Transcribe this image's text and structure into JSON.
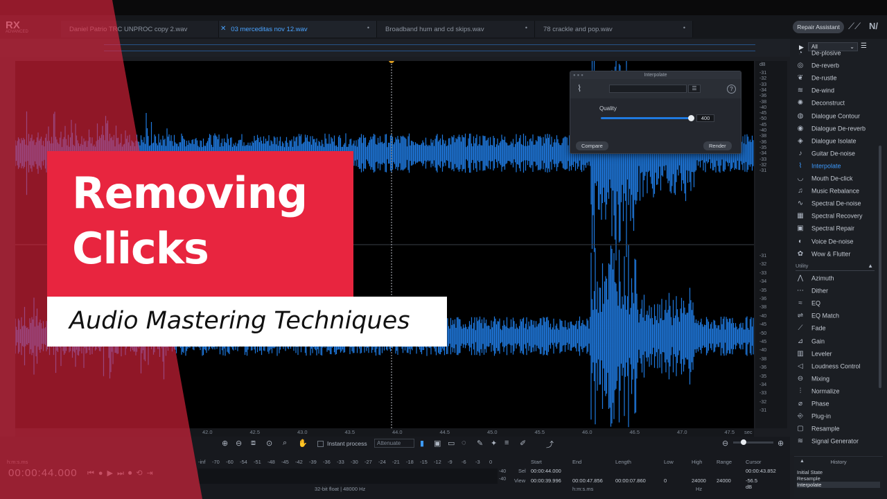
{
  "app": {
    "logo": "RX",
    "logo_sub": "ADVANCED"
  },
  "tabs": [
    {
      "label": "Daniel Patrio TRC UNPROC copy 2.wav",
      "active": false
    },
    {
      "label": "03 merceditas nov 12.wav",
      "active": true
    },
    {
      "label": "Broadband hum and cd skips.wav",
      "active": false
    },
    {
      "label": "78 crackle and pop.wav",
      "active": false
    }
  ],
  "header": {
    "repair_assistant": "Repair Assistant"
  },
  "overlay": {
    "title_line1": "Removing",
    "title_line2": "Clicks",
    "subtitle": "Audio Mastering Techniques",
    "accent": "#e8253f"
  },
  "dialog": {
    "title": "Interpolate",
    "quality_label": "Quality",
    "quality_value": "400",
    "quality_fraction": 0.95,
    "compare": "Compare",
    "render": "Render"
  },
  "db_scale": {
    "unit": "dB",
    "top": [
      "-31",
      "-32",
      "-33",
      "-34",
      "-36",
      "-38",
      "-40",
      "-45",
      "-50",
      "-45",
      "-40",
      "-38",
      "-36",
      "-35",
      "-34",
      "-33",
      "-32",
      "-31"
    ],
    "bottom": [
      "-31",
      "-32",
      "-33",
      "-34",
      "-35",
      "-36",
      "-38",
      "-40",
      "-45",
      "-50",
      "-45",
      "-40",
      "-38",
      "-36",
      "-35",
      "-34",
      "-33",
      "-32",
      "-31"
    ]
  },
  "ruler": {
    "ticks": [
      "42.0",
      "42.5",
      "43.0",
      "43.5",
      "44.0",
      "44.5",
      "45.0",
      "45.5",
      "46.0",
      "46.5",
      "47.0",
      "47.5"
    ],
    "unit": "sec"
  },
  "modules": {
    "filter": "All",
    "repair": [
      {
        "label": "De-plosive",
        "icon": "de-plosive-icon"
      },
      {
        "label": "De-reverb",
        "icon": "de-reverb-icon"
      },
      {
        "label": "De-rustle",
        "icon": "de-rustle-icon"
      },
      {
        "label": "De-wind",
        "icon": "de-wind-icon"
      },
      {
        "label": "Deconstruct",
        "icon": "deconstruct-icon"
      },
      {
        "label": "Dialogue Contour",
        "icon": "dialogue-contour-icon"
      },
      {
        "label": "Dialogue De-reverb",
        "icon": "dialogue-de-reverb-icon"
      },
      {
        "label": "Dialogue Isolate",
        "icon": "dialogue-isolate-icon"
      },
      {
        "label": "Guitar De-noise",
        "icon": "guitar-icon"
      },
      {
        "label": "Interpolate",
        "icon": "interpolate-icon",
        "active": true
      },
      {
        "label": "Mouth De-click",
        "icon": "mouth-icon"
      },
      {
        "label": "Music Rebalance",
        "icon": "music-icon"
      },
      {
        "label": "Spectral De-noise",
        "icon": "spectral-de-noise-icon"
      },
      {
        "label": "Spectral Recovery",
        "icon": "spectral-recovery-icon"
      },
      {
        "label": "Spectral Repair",
        "icon": "spectral-repair-icon"
      },
      {
        "label": "Voice De-noise",
        "icon": "voice-icon"
      },
      {
        "label": "Wow & Flutter",
        "icon": "wow-flutter-icon"
      }
    ],
    "utility_label": "Utility",
    "utility": [
      {
        "label": "Azimuth",
        "icon": "azimuth-icon"
      },
      {
        "label": "Dither",
        "icon": "dither-icon"
      },
      {
        "label": "EQ",
        "icon": "eq-icon"
      },
      {
        "label": "EQ Match",
        "icon": "eq-match-icon"
      },
      {
        "label": "Fade",
        "icon": "fade-icon"
      },
      {
        "label": "Gain",
        "icon": "gain-icon"
      },
      {
        "label": "Leveler",
        "icon": "leveler-icon"
      },
      {
        "label": "Loudness Control",
        "icon": "loudness-icon"
      },
      {
        "label": "Mixing",
        "icon": "mixing-icon"
      },
      {
        "label": "Normalize",
        "icon": "normalize-icon"
      },
      {
        "label": "Phase",
        "icon": "phase-icon"
      },
      {
        "label": "Plug-in",
        "icon": "plug-in-icon"
      },
      {
        "label": "Resample",
        "icon": "resample-icon"
      },
      {
        "label": "Signal Generator",
        "icon": "signal-generator-icon"
      }
    ]
  },
  "toolbar": {
    "instant_process": "Instant process",
    "mode": "Attenuate"
  },
  "transport": {
    "time_format": "h:m:s.ms",
    "timecode": "00:00:44.000"
  },
  "meter": {
    "scale": [
      "-inf",
      "-70",
      "-60",
      "-54",
      "-51",
      "-48",
      "-45",
      "-42",
      "-39",
      "-36",
      "-33",
      "-30",
      "-27",
      "-24",
      "-21",
      "-18",
      "-15",
      "-12",
      "-9",
      "-6",
      "-3",
      "0"
    ],
    "right_labels": [
      "-40",
      "-40"
    ],
    "format": "32-bit float | 48000 Hz"
  },
  "selection": {
    "headers": [
      "Start",
      "End",
      "Length",
      "Low",
      "High",
      "Range",
      "Cursor"
    ],
    "sel_label": "Sel",
    "view_label": "View",
    "sel_start": "00:00:44.000",
    "view_start": "00:00:39.996",
    "view_end": "00:00:47.856",
    "view_length": "00:00:07.860",
    "low": "0",
    "high": "24000",
    "range": "24000",
    "cursor": "00:00:43.852",
    "cursor_db": "-56.5 dB",
    "time_unit": "h:m:s.ms",
    "freq_unit": "Hz"
  },
  "history": {
    "title": "History",
    "items": [
      "Initial State",
      "Resample",
      "Interpolate"
    ]
  }
}
